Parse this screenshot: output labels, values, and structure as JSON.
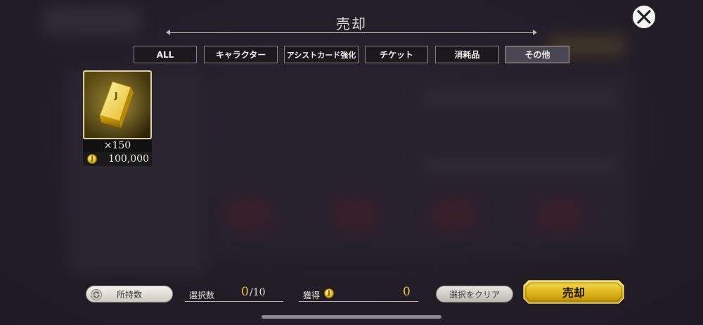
{
  "header": {
    "title": "売却"
  },
  "tabs": [
    {
      "label": "ALL",
      "active": false
    },
    {
      "label": "キャラクター",
      "active": false
    },
    {
      "label": "アシストカード強化",
      "active": false
    },
    {
      "label": "チケット",
      "active": false
    },
    {
      "label": "消耗品",
      "active": false
    },
    {
      "label": "その他",
      "active": true
    }
  ],
  "item": {
    "icon": "gold-bar-icon",
    "count": "×150",
    "price": "100,000",
    "currency_icon": "gold-coin-icon"
  },
  "footer": {
    "owned_button": "所持数",
    "selected_label": "選択数",
    "selected_value": "0",
    "selected_max": "/10",
    "gain_label": "獲得",
    "gain_value": "0",
    "clear_button": "選択をクリア",
    "sell_button": "売却"
  },
  "colors": {
    "accent_gold": "#e8c848",
    "tab_border": "#8c8478",
    "background": "#2a2430"
  }
}
